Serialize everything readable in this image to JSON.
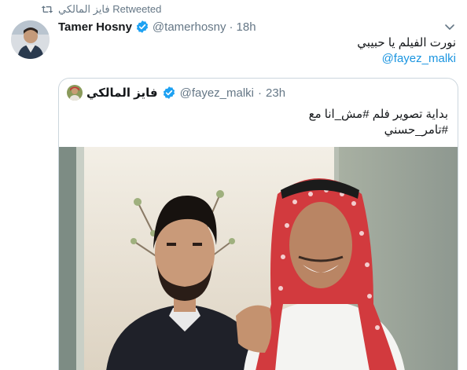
{
  "retweet": {
    "icon": "retweet-icon",
    "label": "فايز المالكي Retweeted"
  },
  "tweet": {
    "display_name": "Tamer Hosny",
    "handle": "@tamerhosny",
    "separator": "·",
    "time": "18h",
    "text": "نورت الفيلم يا حبيبي",
    "mention": "@fayez_malki",
    "colors": {
      "link": "#1b95e0",
      "verified": "#1da1f2",
      "secondary": "#657786"
    }
  },
  "quote": {
    "display_name": "فايز المالكي",
    "handle": "@fayez_malki",
    "separator": "·",
    "time": "23h",
    "text_line1": "بداية تصوير فلم #مش_انا مع",
    "text_line2": "#تامر_حسني"
  }
}
